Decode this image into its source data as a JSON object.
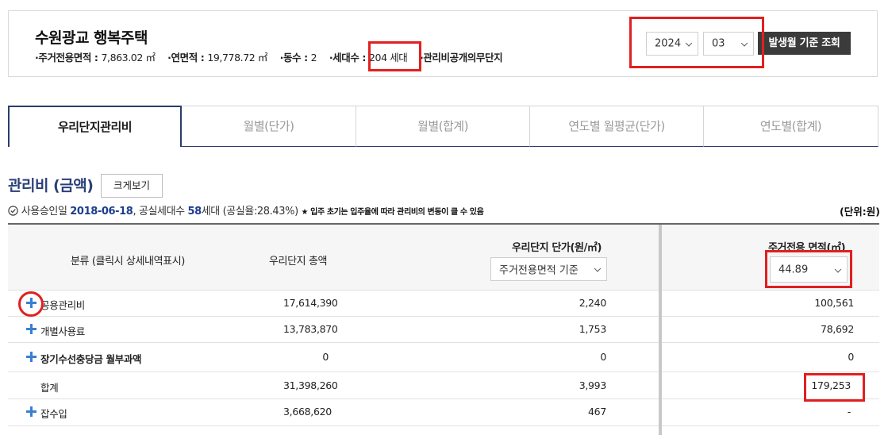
{
  "header": {
    "apt_name": "수원광교 행복주택",
    "info": {
      "area_label": "·주거전용면적 : ",
      "area_value": "7,863.02 ㎡",
      "floor_label": "·연면적 : ",
      "floor_value": "19,778.72 ㎡",
      "buildings_label": "·동수 : ",
      "buildings_value": "2",
      "households_label": "·세대수 : ",
      "households_value": "204 세대",
      "disclosure": "·관리비공개의무단지"
    },
    "year": "2024",
    "month": "03",
    "query_button": "발생월 기준 조회"
  },
  "tabs": [
    {
      "label": "우리단지관리비"
    },
    {
      "label": "월별(단가)"
    },
    {
      "label": "월별(합계)"
    },
    {
      "label": "연도별 월평균(단가)"
    },
    {
      "label": "연도별(합계)"
    }
  ],
  "section": {
    "title": "관리비 (금액)",
    "enlarge_button": "크게보기",
    "approval_label": "사용승인일 ",
    "approval_date": "2018-06-18",
    "vacancy_label": ", 공실세대수 ",
    "vacancy_count": "58",
    "vacancy_unit": "세대 (공실율:28.43%)",
    "note": "★ 입주 초기는 입주율에 따라 관리비의 변동이 클 수 있음",
    "unit": "(단위:원)"
  },
  "table": {
    "headers": {
      "category": "분류 (클릭시 상세내역표시)",
      "total": "우리단지 총액",
      "unit_price": "우리단지 단가(원/㎡)",
      "unit_basis": "주거전용면적 기준",
      "area": "주거전용 면적(㎡)",
      "area_value": "44.89"
    },
    "rows": [
      {
        "label": "공용관리비",
        "total": "17,614,390",
        "unit": "2,240",
        "area": "100,561"
      },
      {
        "label": "개별사용료",
        "total": "13,783,870",
        "unit": "1,753",
        "area": "78,692"
      },
      {
        "label": "장기수선충당금 월부과액",
        "total": "0",
        "unit": "0",
        "area": "0"
      },
      {
        "label": "합계",
        "total": "31,398,260",
        "unit": "3,993",
        "area": "179,253"
      },
      {
        "label": "잡수입",
        "total": "3,668,620",
        "unit": "467",
        "area": "-"
      }
    ]
  },
  "colors": {
    "accent": "#2a3d6e",
    "highlight": "#e02020",
    "plus": "#3a7fd0"
  }
}
